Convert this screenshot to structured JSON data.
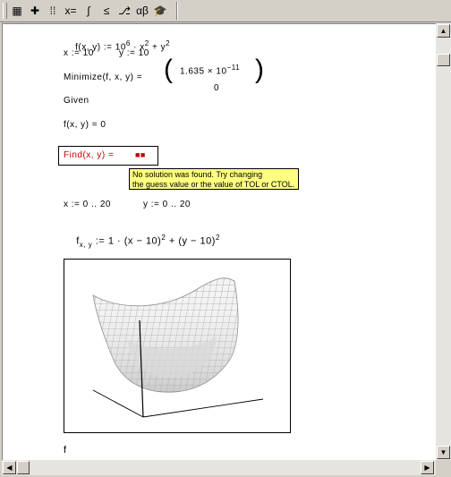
{
  "toolbar": {
    "buttons": [
      {
        "name": "calculator-icon",
        "glyph": "▦"
      },
      {
        "name": "graph-icon",
        "glyph": "✚"
      },
      {
        "name": "matrix-icon",
        "glyph": "⁞⁞"
      },
      {
        "name": "evaluation-icon",
        "glyph": "x="
      },
      {
        "name": "calculus-icon",
        "glyph": "∫"
      },
      {
        "name": "boolean-icon",
        "glyph": "≤"
      },
      {
        "name": "programming-icon",
        "glyph": "⎇"
      },
      {
        "name": "greek-icon",
        "glyph": "αβ"
      },
      {
        "name": "symbolic-icon",
        "glyph": "🎓"
      }
    ]
  },
  "worksheet": {
    "line1": "f(x, y) := 10",
    "line1_exp": "6",
    "line1_b": "· x",
    "line1_exp2": "2",
    "line1_c": "+ y",
    "line1_exp3": "2",
    "line2_x": "x := 10",
    "line2_y": "y := 10",
    "minimize": "Minimize(f, x, y) =",
    "min_val1": "1.635 × 10",
    "min_exp": "−11",
    "min_val2": "0",
    "given": "Given",
    "constraint": "f(x, y) = 0",
    "find": "Find(x, y) =",
    "find_result": "■■",
    "tooltip_line1": "No solution was found. Try changing",
    "tooltip_line2": "the guess value or the value of TOL or CTOL.",
    "range_x": "x := 0 .. 20",
    "range_y": "y := 0 .. 20",
    "matrix_def": "f",
    "matrix_sub": "x, y",
    "matrix_rhs": ":= 1 · (x − 10)",
    "matrix_exp": "2",
    "matrix_rhs2": "+ (y − 10)",
    "matrix_exp2": "2",
    "plot_label": "f"
  }
}
